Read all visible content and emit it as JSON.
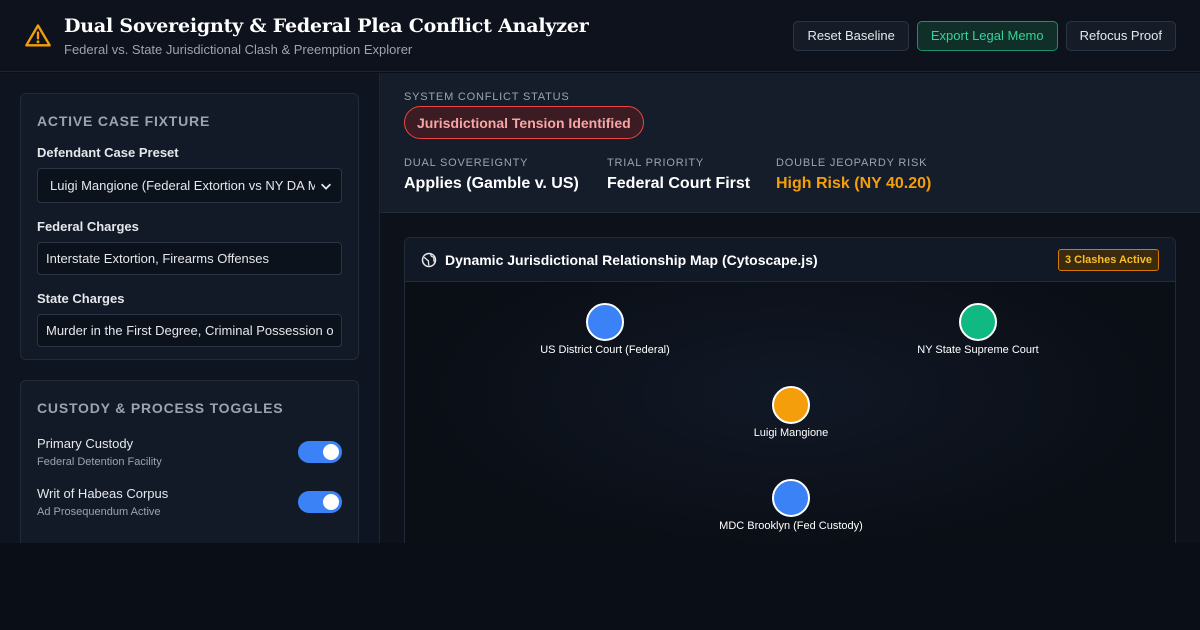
{
  "header": {
    "title": "Dual Sovereignty & Federal Plea Conflict Analyzer",
    "subtitle": "Federal vs. State Jurisdictional Clash & Preemption Explorer",
    "buttons": {
      "reset": "Reset Baseline",
      "export": "Export Legal Memo",
      "refocus": "Refocus Proof"
    }
  },
  "sidebar": {
    "case_fixture": {
      "title": "Active Case Fixture",
      "preset_label": "Defendant Case Preset",
      "preset_value": "Luigi Mangione (Federal Extortion vs NY DA Murder)",
      "federal_label": "Federal Charges",
      "federal_value": "Interstate Extortion, Firearms Offenses",
      "state_label": "State Charges",
      "state_value": "Murder in the First Degree, Criminal Possession of a Weapon"
    },
    "toggles": {
      "title": "Custody & Process Toggles",
      "items": [
        {
          "name": "Primary Custody",
          "sub": "Federal Detention Facility",
          "on": true
        },
        {
          "name": "Writ of Habeas Corpus",
          "sub": "Ad Prosequendum Active",
          "on": true
        }
      ]
    }
  },
  "status": {
    "label": "System Conflict Status",
    "badge": "Jurisdictional Tension Identified",
    "metrics": [
      {
        "label": "Dual Sovereignty",
        "value": "Applies (Gamble v. US)"
      },
      {
        "label": "Trial Priority",
        "value": "Federal Court First"
      },
      {
        "label": "Double Jeopardy Risk",
        "value": "High Risk (NY 40.20)"
      }
    ]
  },
  "graph": {
    "title": "Dynamic Jurisdictional Relationship Map (Cytoscape.js)",
    "badge": "3 Clashes Active",
    "nodes": [
      {
        "label": "US District Court (Federal)",
        "color": "#3b82f6"
      },
      {
        "label": "NY State Supreme Court",
        "color": "#10b981"
      },
      {
        "label": "Luigi Mangione",
        "color": "#f59e0b"
      },
      {
        "label": "MDC Brooklyn (Fed Custody)",
        "color": "#3b82f6"
      }
    ]
  },
  "colors": {
    "accent_blue": "#3b82f6",
    "accent_green": "#10b981",
    "warning_orange": "#f59e0b",
    "danger_red": "#ef4444"
  }
}
